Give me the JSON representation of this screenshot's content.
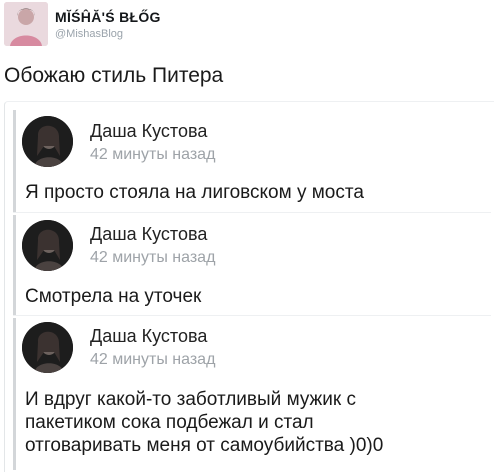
{
  "tweet": {
    "display_name": "MĬŚĤĂ'Ś BŁŐG",
    "handle": "@MishasBlog",
    "text": "Обожаю стиль Питера"
  },
  "posts": [
    {
      "author": "Даша Кустова",
      "time": "42 минуты назад",
      "lines": [
        "Я просто стояла на лиговском у моста"
      ]
    },
    {
      "author": "Даша Кустова",
      "time": "42 минуты назад",
      "lines": [
        "Смотрела на уточек"
      ]
    },
    {
      "author": "Даша Кустова",
      "time": "42 минуты назад",
      "lines": [
        "И вдруг какой-то заботливый мужик с",
        "пакетиком сока подбежал и стал",
        "отговаривать меня от самоубийства )0)0"
      ]
    }
  ]
}
